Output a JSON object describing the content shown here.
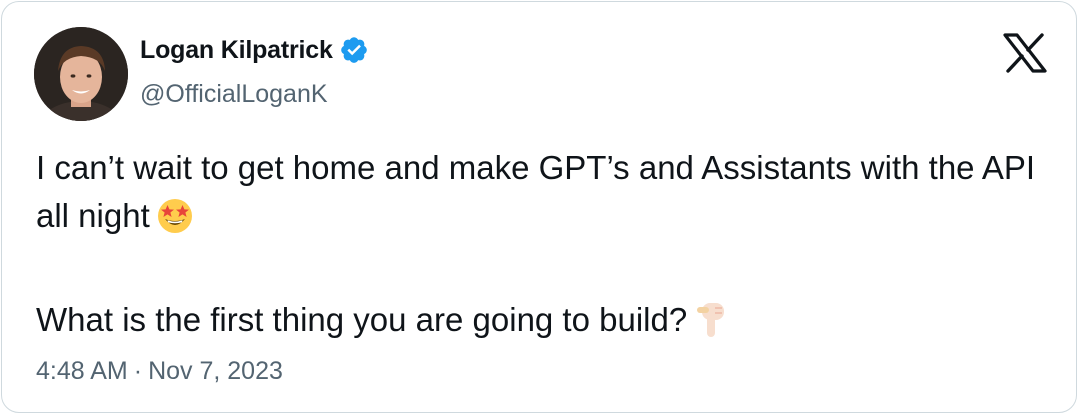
{
  "author": {
    "name": "Logan Kilpatrick",
    "handle": "@OfficialLoganK",
    "verified": true
  },
  "tweet": {
    "line1": "I can’t wait to get home and make GPT’s and Assistants with the API all night",
    "line1_emoji": "star-struck-emoji",
    "line2": "What is the first thing you are going to build?",
    "line2_emoji": "backhand-index-pointing-down-emoji"
  },
  "timestamp": {
    "time": "4:48 AM",
    "separator": "·",
    "date": "Nov 7, 2023"
  },
  "icons": {
    "brand_logo": "x-logo-icon",
    "verified": "verified-badge-icon"
  },
  "colors": {
    "text_primary": "#0f1419",
    "text_secondary": "#536471",
    "verified_blue": "#1d9bf0",
    "border": "#cfd9de"
  }
}
